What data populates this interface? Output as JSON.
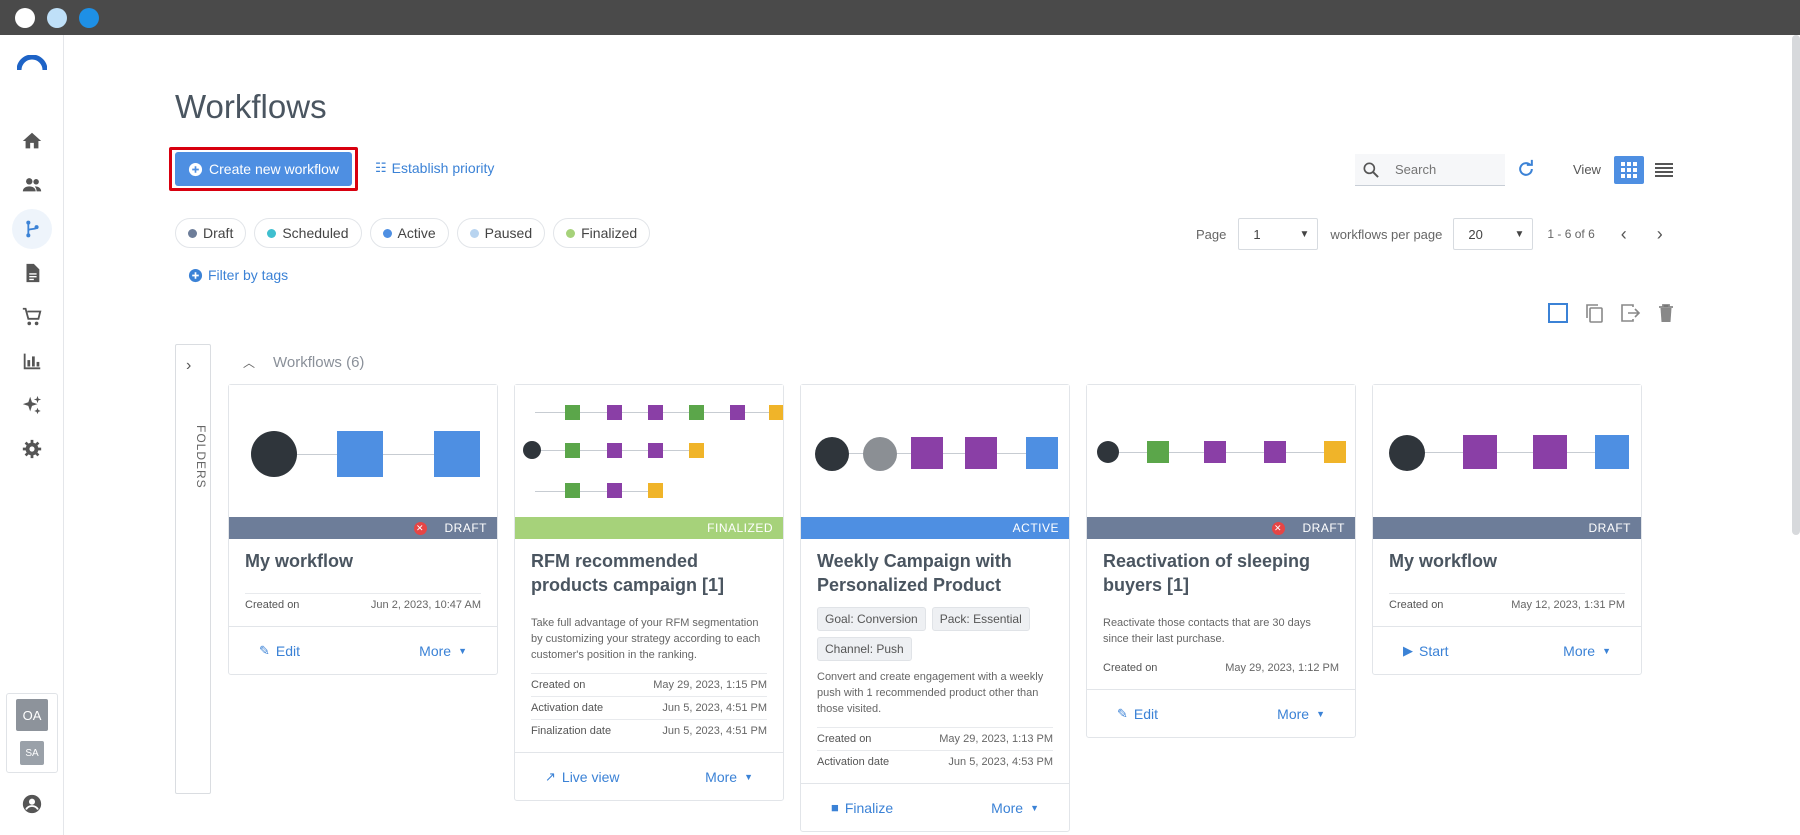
{
  "page": {
    "title": "Workflows"
  },
  "sidebar": {
    "items": [
      "home-icon",
      "contacts-icon",
      "workflows-icon",
      "templates-icon",
      "ecommerce-icon",
      "reports-icon",
      "ai-icon",
      "settings-icon"
    ],
    "avatar_primary": "OA",
    "avatar_secondary": "SA"
  },
  "toolbar": {
    "create_label": "Create new workflow",
    "priority_label": "Establish priority",
    "search_placeholder": "Search",
    "view_label": "View"
  },
  "filters": {
    "chips": [
      {
        "label": "Draft",
        "color": "#6d7d99"
      },
      {
        "label": "Scheduled",
        "color": "#3fbfcf"
      },
      {
        "label": "Active",
        "color": "#4e8fe2"
      },
      {
        "label": "Paused",
        "color": "#b8d4f0"
      },
      {
        "label": "Finalized",
        "color": "#a6d27a"
      }
    ],
    "tags_label": "Filter by tags"
  },
  "pagination": {
    "page_label": "Page",
    "page_value": "1",
    "per_page_label": "workflows per page",
    "per_page_value": "20",
    "range": "1 - 6 of 6"
  },
  "folders": {
    "label": "FOLDERS"
  },
  "group": {
    "label": "Workflows (6)"
  },
  "cards": [
    {
      "status": "DRAFT",
      "title": "My workflow",
      "meta": [
        {
          "k": "Created on",
          "v": "Jun 2, 2023, 10:47 AM"
        }
      ],
      "action1": "Edit",
      "action2": "More"
    },
    {
      "status": "FINALIZED",
      "title": "RFM recommended products campaign [1]",
      "desc": "Take full advantage of your RFM segmentation by customizing your strategy according to each customer's position in the ranking.",
      "meta": [
        {
          "k": "Created on",
          "v": "May 29, 2023, 1:15 PM"
        },
        {
          "k": "Activation date",
          "v": "Jun 5, 2023, 4:51 PM"
        },
        {
          "k": "Finalization date",
          "v": "Jun 5, 2023, 4:51 PM"
        }
      ],
      "action1": "Live view",
      "action2": "More"
    },
    {
      "status": "ACTIVE",
      "title": "Weekly Campaign with Personalized Product",
      "tags": [
        "Goal: Conversion",
        "Pack: Essential",
        "Channel: Push"
      ],
      "desc": "Convert and create engagement with a weekly push with 1 recommended product other than those visited.",
      "meta": [
        {
          "k": "Created on",
          "v": "May 29, 2023, 1:13 PM"
        },
        {
          "k": "Activation date",
          "v": "Jun 5, 2023, 4:53 PM"
        }
      ],
      "action1": "Finalize",
      "action2": "More"
    },
    {
      "status": "DRAFT",
      "title": "Reactivation of sleeping buyers [1]",
      "desc": "Reactivate those contacts that are 30 days since their last purchase.",
      "meta": [
        {
          "k": "Created on",
          "v": "May 29, 2023, 1:12 PM"
        }
      ],
      "action1": "Edit",
      "action2": "More"
    },
    {
      "status": "DRAFT",
      "title": "My workflow",
      "meta": [
        {
          "k": "Created on",
          "v": "May 12, 2023, 1:31 PM"
        }
      ],
      "action1": "Start",
      "action2": "More"
    }
  ]
}
